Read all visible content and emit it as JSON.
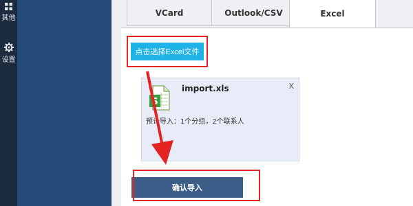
{
  "nav": {
    "other_label": "其他",
    "settings_label": "设置"
  },
  "tabs": [
    {
      "label": "VCard"
    },
    {
      "label": "Outlook/CSV"
    },
    {
      "label": "Excel"
    }
  ],
  "import": {
    "choose_button_label": "点击选择Excel文件",
    "file": {
      "name": "import.xls",
      "close_label": "X",
      "preview": "预计导入：1个分组，2个联系人"
    },
    "confirm_button_label": "确认导入"
  },
  "colors": {
    "nav_bg": "#1b2a3d",
    "backdrop": "#244a79",
    "accent": "#1fb3e8",
    "confirm": "#3b5d87",
    "annotation": "#e32222"
  }
}
